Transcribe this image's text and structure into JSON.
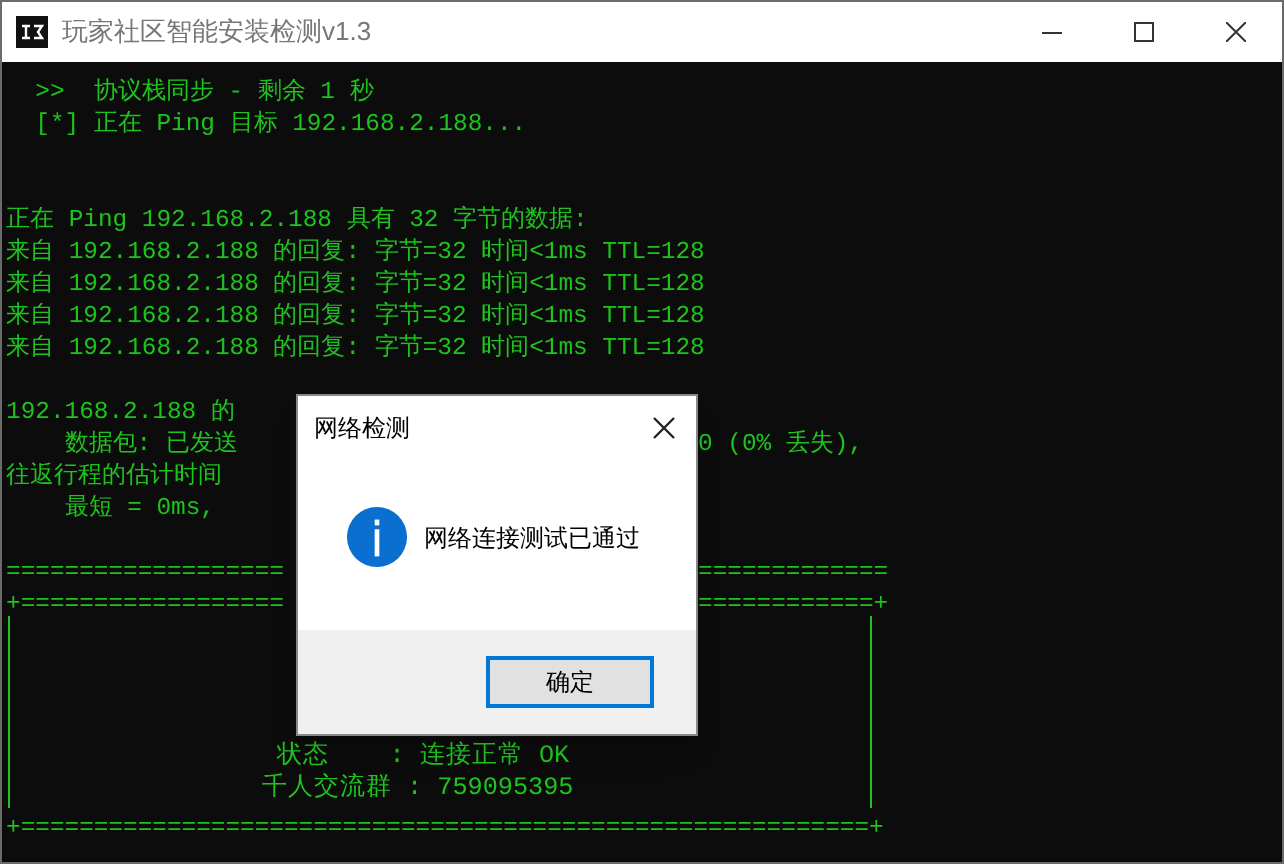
{
  "window": {
    "title": "玩家社区智能安装检测v1.3"
  },
  "console": {
    "lines": [
      {
        "kind": "text",
        "text": "  >>  协议栈同步 - 剩余 1 秒"
      },
      {
        "kind": "text",
        "text": "  [*] 正在 Ping 目标 192.168.2.188..."
      },
      {
        "kind": "blank"
      },
      {
        "kind": "blank"
      },
      {
        "kind": "text",
        "text": "正在 Ping 192.168.2.188 具有 32 字节的数据:"
      },
      {
        "kind": "text",
        "text": "来自 192.168.2.188 的回复: 字节=32 时间<1ms TTL=128"
      },
      {
        "kind": "text",
        "text": "来自 192.168.2.188 的回复: 字节=32 时间<1ms TTL=128"
      },
      {
        "kind": "text",
        "text": "来自 192.168.2.188 的回复: 字节=32 时间<1ms TTL=128"
      },
      {
        "kind": "text",
        "text": "来自 192.168.2.188 的回复: 字节=32 时间<1ms TTL=128"
      },
      {
        "kind": "blank"
      },
      {
        "kind": "text",
        "text": "192.168.2.188 的"
      },
      {
        "kind": "text",
        "text": "    数据包: 已发送",
        "right": "0 (0% 丢失),"
      },
      {
        "kind": "text",
        "text": "往返行程的估计时间"
      },
      {
        "kind": "text",
        "text": "    最短 = 0ms,"
      },
      {
        "kind": "blank"
      },
      {
        "kind": "text",
        "text": "===================",
        "right": "============="
      },
      {
        "kind": "text",
        "text": "+==================",
        "right": "============+"
      }
    ],
    "box": {
      "lines": [
        " 状态    : 连接正常 OK",
        "千人交流群 : 759095395"
      ]
    },
    "footer": "+==========================================================+"
  },
  "dialog": {
    "title": "网络检测",
    "message": "网络连接测试已通过",
    "button": "确定"
  }
}
